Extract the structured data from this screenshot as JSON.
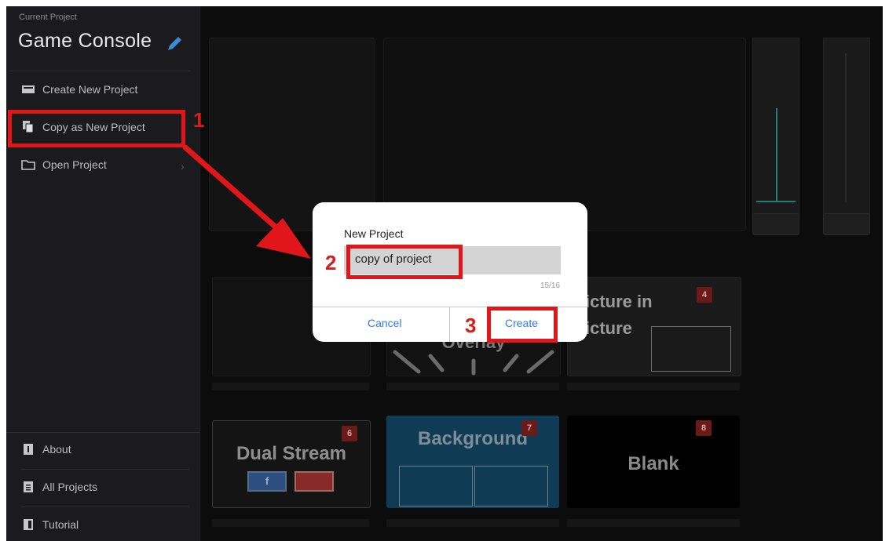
{
  "sidebar": {
    "current_project_label": "Current Project",
    "project_name": "Game Console",
    "items": [
      {
        "label": "Create New Project",
        "icon": "monitor-icon"
      },
      {
        "label": "Copy as New Project",
        "icon": "copy-icon"
      },
      {
        "label": "Open Project",
        "icon": "folder-icon"
      }
    ],
    "bottom_items": [
      {
        "label": "About",
        "icon": "info-icon"
      },
      {
        "label": "All Projects",
        "icon": "list-icon"
      },
      {
        "label": "Tutorial",
        "icon": "book-icon"
      }
    ]
  },
  "tiles": {
    "picture_in_picture": {
      "line1": "icture in",
      "line2": "icture",
      "badge": "4"
    },
    "overlay": {
      "label": "Overlay"
    },
    "dual_stream": {
      "label": "Dual Stream",
      "badge": "6"
    },
    "background": {
      "label": "Background",
      "badge": "7"
    },
    "blank": {
      "label": "Blank",
      "badge": "8"
    }
  },
  "dialog": {
    "title": "New Project",
    "input_value": "copy of project",
    "char_count": "15/16",
    "cancel_label": "Cancel",
    "create_label": "Create"
  },
  "annotations": {
    "step1": "1",
    "step2": "2",
    "step3": "3"
  },
  "colors": {
    "annotation_red": "#e0161b",
    "accent_blue": "#3478f6",
    "meter_teal": "#1f7f76"
  }
}
